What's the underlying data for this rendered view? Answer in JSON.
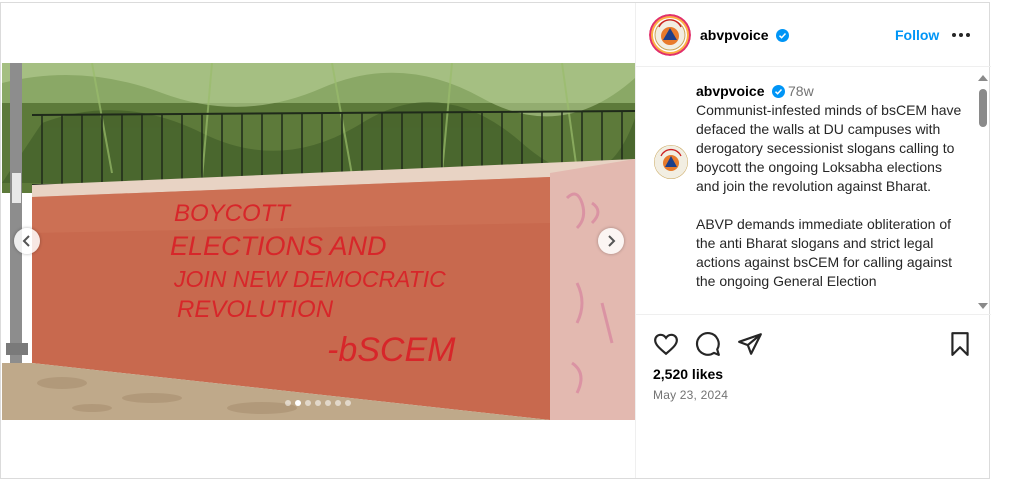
{
  "header": {
    "username": "abvpvoice",
    "verified": true,
    "follow_label": "Follow",
    "more_icon": "more-dots-icon"
  },
  "media": {
    "graffiti_lines": [
      "BOYCOTT",
      "ELECTIONS AND",
      "JOIN NEW DEMOCRATIC",
      "REVOLUTION",
      "-bSCEM"
    ],
    "slide_count": 7,
    "active_slide": 2
  },
  "caption": {
    "username": "abvpvoice",
    "time": "78w",
    "paragraph1": "Communist-infested minds of bsCEM have defaced the walls at DU campuses with derogatory secessionist slogans calling to boycott the ongoing Loksabha elections and join the revolution against Bharat.",
    "paragraph2": "ABVP demands immediate obliteration of the anti Bharat slogans and strict legal actions against bsCEM for calling against the ongoing General Election"
  },
  "footer": {
    "likes": "2,520 likes",
    "date": "May 23, 2024"
  },
  "colors": {
    "accent": "#0095f6",
    "verified": "#0095f6",
    "graffiti": "#d7262a"
  }
}
